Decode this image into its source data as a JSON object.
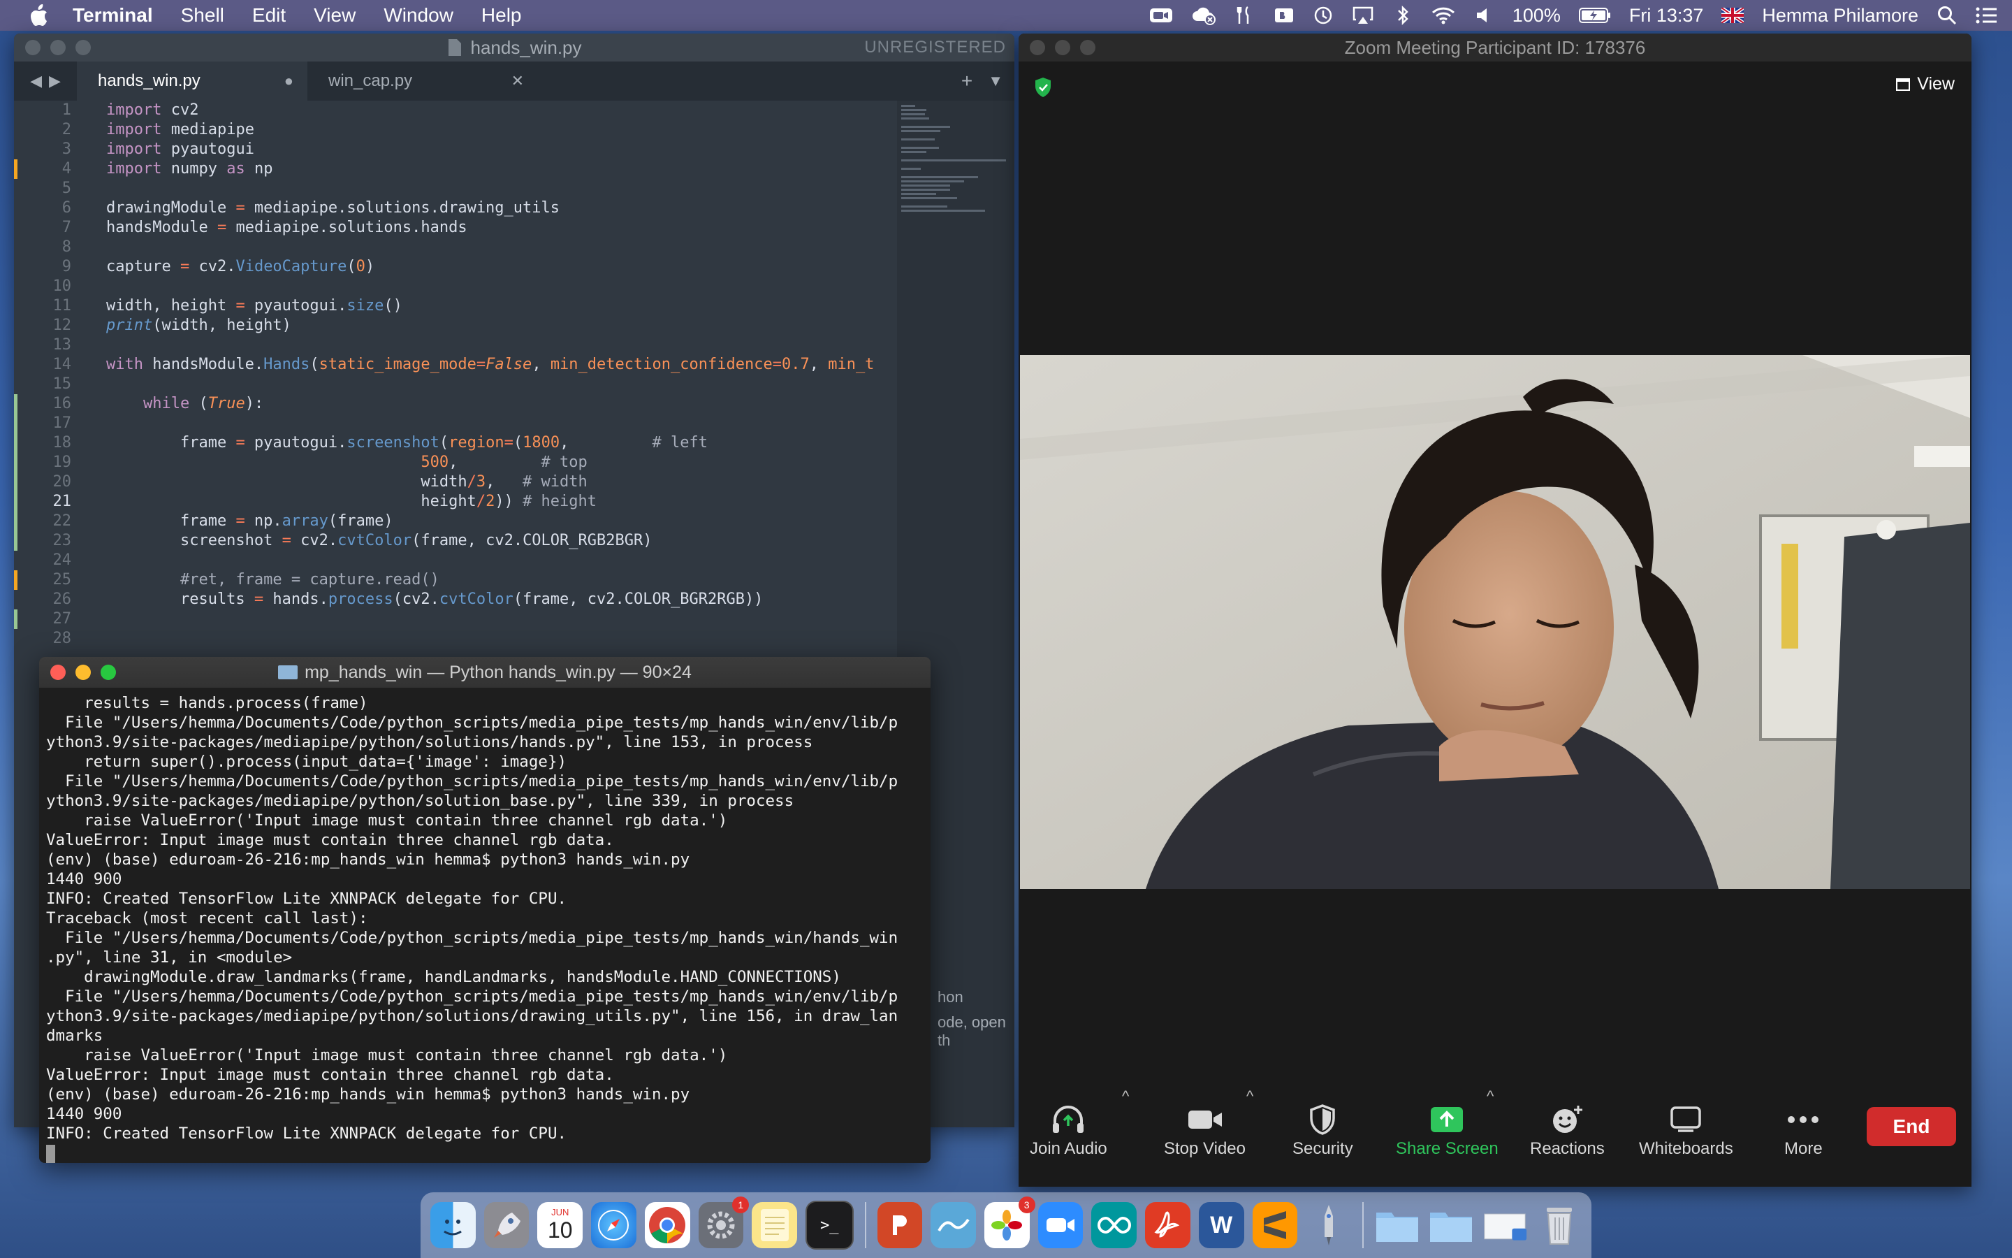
{
  "menubar": {
    "app_name": "Terminal",
    "items": [
      "Shell",
      "Edit",
      "View",
      "Window",
      "Help"
    ],
    "battery": "100%",
    "clock": "Fri 13:37",
    "user": "Hemma Philamore"
  },
  "editor": {
    "window_title": "hands_win.py",
    "unregistered": "UNREGISTERED",
    "tabs": [
      {
        "label": "hands_win.py",
        "modified": true
      },
      {
        "label": "win_cap.py",
        "modified": false
      }
    ],
    "current_line": 21,
    "status_fragment": "hon",
    "status_fragment2": "ode, open th"
  },
  "terminal": {
    "title": "mp_hands_win — Python hands_win.py — 90×24",
    "lines": [
      "    results = hands.process(frame)",
      "  File \"/Users/hemma/Documents/Code/python_scripts/media_pipe_tests/mp_hands_win/env/lib/p",
      "ython3.9/site-packages/mediapipe/python/solutions/hands.py\", line 153, in process",
      "    return super().process(input_data={'image': image})",
      "  File \"/Users/hemma/Documents/Code/python_scripts/media_pipe_tests/mp_hands_win/env/lib/p",
      "ython3.9/site-packages/mediapipe/python/solution_base.py\", line 339, in process",
      "    raise ValueError('Input image must contain three channel rgb data.')",
      "ValueError: Input image must contain three channel rgb data.",
      "(env) (base) eduroam-26-216:mp_hands_win hemma$ python3 hands_win.py",
      "1440 900",
      "INFO: Created TensorFlow Lite XNNPACK delegate for CPU.",
      "Traceback (most recent call last):",
      "  File \"/Users/hemma/Documents/Code/python_scripts/media_pipe_tests/mp_hands_win/hands_win",
      ".py\", line 31, in <module>",
      "    drawingModule.draw_landmarks(frame, handLandmarks, handsModule.HAND_CONNECTIONS)",
      "  File \"/Users/hemma/Documents/Code/python_scripts/media_pipe_tests/mp_hands_win/env/lib/p",
      "ython3.9/site-packages/mediapipe/python/solutions/drawing_utils.py\", line 156, in draw_lan",
      "dmarks",
      "    raise ValueError('Input image must contain three channel rgb data.')",
      "ValueError: Input image must contain three channel rgb data.",
      "(env) (base) eduroam-26-216:mp_hands_win hemma$ python3 hands_win.py",
      "1440 900",
      "INFO: Created TensorFlow Lite XNNPACK delegate for CPU."
    ]
  },
  "zoom": {
    "title": "Zoom Meeting Participant ID: 178376",
    "view_label": "View",
    "toolbar": {
      "join_audio": "Join Audio",
      "stop_video": "Stop Video",
      "security": "Security",
      "share_screen": "Share Screen",
      "reactions": "Reactions",
      "whiteboards": "Whiteboards",
      "more": "More",
      "end": "End"
    }
  },
  "dock": {
    "calendar_month": "JUN",
    "calendar_day": "10",
    "settings_badge": "1",
    "photos_badge": "3"
  },
  "colors": {
    "menubar": "#5b5a86",
    "editor_bg": "#303841",
    "terminal_bg": "#1e1e1e",
    "zoom_bg": "#1a1a1a",
    "share_green": "#2fc55c",
    "end_red": "#d12c2c"
  }
}
